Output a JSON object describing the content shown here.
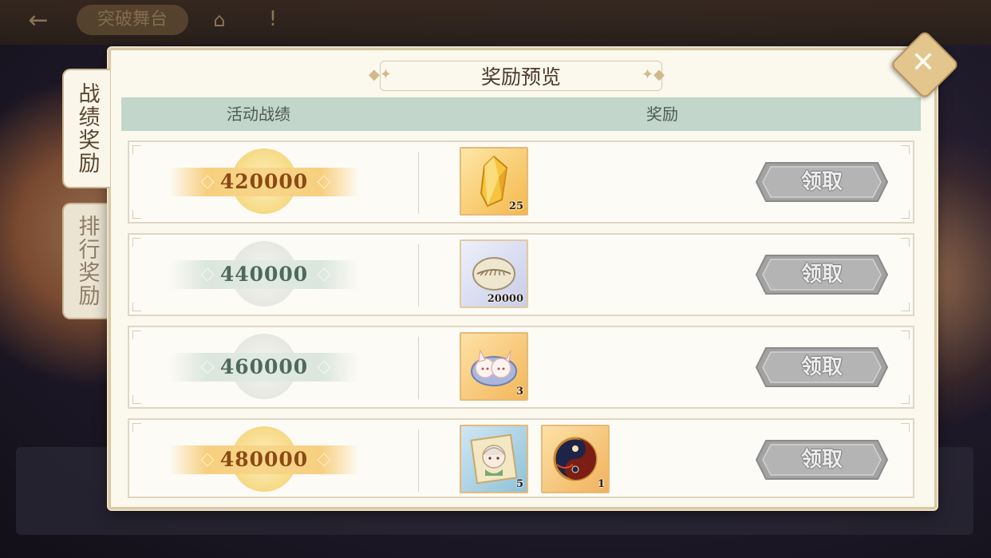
{
  "background": {
    "back_icon": "arrow-left-icon",
    "title": "突破舞台",
    "home_icon": "home-icon",
    "warning_icon": "warning-icon"
  },
  "tabs": [
    {
      "label": "战绩奖励",
      "active": true
    },
    {
      "label": "排行奖励",
      "active": false
    }
  ],
  "panel": {
    "title": "奖励预览",
    "close_icon": "close-icon"
  },
  "table": {
    "headers": {
      "score": "活动战绩",
      "reward": "奖励"
    },
    "rows": [
      {
        "score": "420000",
        "tier": "gold",
        "items": [
          {
            "icon": "amber-crystal-icon",
            "qty": "25"
          }
        ],
        "claim_label": "领取"
      },
      {
        "score": "440000",
        "tier": "gray",
        "items": [
          {
            "icon": "shell-coin-icon",
            "qty": "20000"
          }
        ],
        "claim_label": "领取"
      },
      {
        "score": "460000",
        "tier": "gray",
        "items": [
          {
            "icon": "bunny-dumplings-icon",
            "qty": "3"
          }
        ],
        "claim_label": "领取"
      },
      {
        "score": "480000",
        "tier": "gold",
        "items": [
          {
            "icon": "character-portrait-icon",
            "qty": "5"
          },
          {
            "icon": "yin-yang-emblem-icon",
            "qty": "1"
          }
        ],
        "claim_label": "领取"
      }
    ]
  },
  "colors": {
    "panel_bg": "#fbf8ee",
    "header_bg": "#c2d6cb",
    "gold_text": "#8a4a14",
    "gray_text": "#4f6a5c",
    "claim_button": "#9c9c9c"
  }
}
